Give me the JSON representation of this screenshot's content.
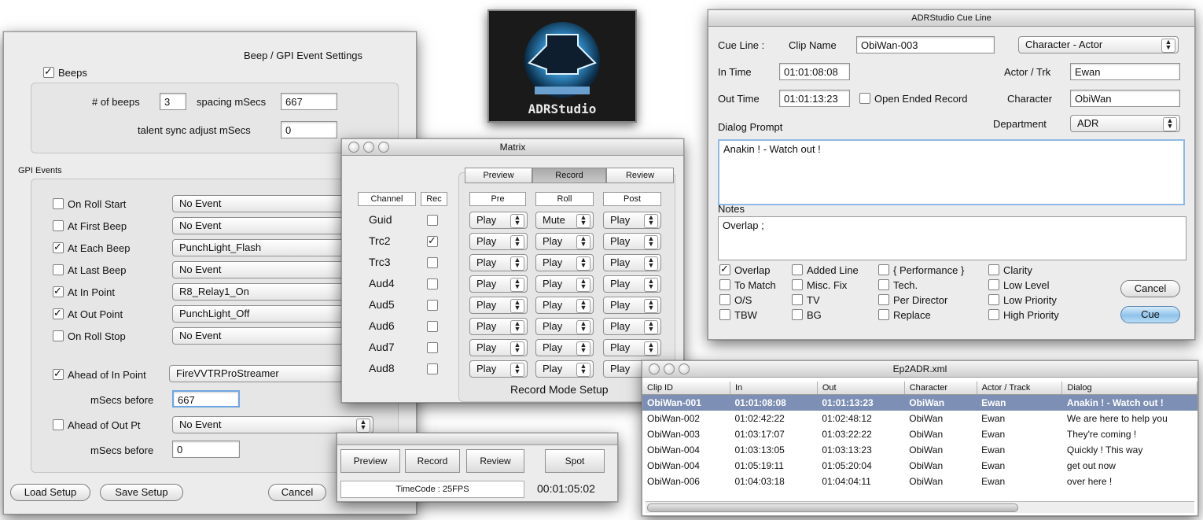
{
  "beep": {
    "title": "Beep / GPI Event Settings",
    "beeps_label": "Beeps",
    "num_beeps_label": "# of beeps",
    "num_beeps": "3",
    "spacing_label": "spacing mSecs",
    "spacing": "667",
    "talent_label": "talent sync adjust mSecs",
    "talent": "0",
    "gpi_label": "GPI Events",
    "events": [
      {
        "label": "On Roll Start",
        "checked": false,
        "value": "No Event"
      },
      {
        "label": "At First Beep",
        "checked": false,
        "value": "No Event"
      },
      {
        "label": "At Each Beep",
        "checked": true,
        "value": "PunchLight_Flash"
      },
      {
        "label": "At Last Beep",
        "checked": false,
        "value": "No Event"
      },
      {
        "label": "At In Point",
        "checked": true,
        "value": "R8_Relay1_On"
      },
      {
        "label": "At Out Point",
        "checked": true,
        "value": "PunchLight_Off"
      },
      {
        "label": "On Roll Stop",
        "checked": false,
        "value": "No Event"
      }
    ],
    "ahead_in_label": "Ahead of In Point",
    "ahead_in_value": "FireVVTRProStreamer",
    "msecs_before_label": "mSecs before",
    "ahead_in_msecs": "667",
    "ahead_out_label": "Ahead of Out Pt",
    "ahead_out_value": "No Event",
    "ahead_out_msecs": "0",
    "load": "Load Setup",
    "save": "Save Setup",
    "cancel": "Cancel"
  },
  "logo": {
    "text": "ADRStudio"
  },
  "matrix": {
    "title": "Matrix",
    "tabs": [
      "Preview",
      "Record",
      "Review"
    ],
    "channel_header": "Channel",
    "rec_header": "Rec",
    "col_headers": [
      "Pre",
      "Roll",
      "Post"
    ],
    "rows": [
      {
        "name": "Guid",
        "rec": false,
        "pre": "Play",
        "roll": "Mute",
        "post": "Play"
      },
      {
        "name": "Trc2",
        "rec": true,
        "pre": "Play",
        "roll": "Play",
        "post": "Play"
      },
      {
        "name": "Trc3",
        "rec": false,
        "pre": "Play",
        "roll": "Play",
        "post": "Play"
      },
      {
        "name": "Aud4",
        "rec": false,
        "pre": "Play",
        "roll": "Play",
        "post": "Play"
      },
      {
        "name": "Aud5",
        "rec": false,
        "pre": "Play",
        "roll": "Play",
        "post": "Play"
      },
      {
        "name": "Aud6",
        "rec": false,
        "pre": "Play",
        "roll": "Play",
        "post": "Play"
      },
      {
        "name": "Aud7",
        "rec": false,
        "pre": "Play",
        "roll": "Play",
        "post": "Play"
      },
      {
        "name": "Aud8",
        "rec": false,
        "pre": "Play",
        "roll": "Play",
        "post": "Play"
      }
    ],
    "footer": "Record Mode Setup"
  },
  "transport": {
    "buttons": [
      "Preview",
      "Record",
      "Review",
      "Spot"
    ],
    "timecode_label": "TimeCode : 25FPS",
    "timecode": "00:01:05:02"
  },
  "cue": {
    "title": "ADRStudio Cue Line",
    "cue_line_label": "Cue Line :",
    "clip_name_label": "Clip Name",
    "clip_name": "ObiWan-003",
    "sort_select": "Character - Actor",
    "in_time_label": "In Time",
    "in_time": "01:01:08:08",
    "actor_label": "Actor / Trk",
    "actor": "Ewan",
    "out_time_label": "Out Time",
    "out_time": "01:01:13:23",
    "open_ended_label": "Open Ended Record",
    "character_label": "Character",
    "character": "ObiWan",
    "dialog_label": "Dialog Prompt",
    "department_label": "Department",
    "department": "ADR",
    "dialog": "Anakin ! - Watch out !",
    "notes_label": "Notes",
    "notes": "Overlap ;",
    "checks": [
      [
        {
          "label": "Overlap",
          "on": true
        },
        {
          "label": "To Match",
          "on": false
        },
        {
          "label": "O/S",
          "on": false
        },
        {
          "label": "TBW",
          "on": false
        }
      ],
      [
        {
          "label": "Added Line",
          "on": false
        },
        {
          "label": "Misc. Fix",
          "on": false
        },
        {
          "label": "TV",
          "on": false
        },
        {
          "label": "BG",
          "on": false
        }
      ],
      [
        {
          "label": "{ Performance }",
          "on": false
        },
        {
          "label": "Tech.",
          "on": false
        },
        {
          "label": "Per Director",
          "on": false
        },
        {
          "label": "Replace",
          "on": false
        }
      ],
      [
        {
          "label": "Clarity",
          "on": false
        },
        {
          "label": "Low Level",
          "on": false
        },
        {
          "label": "Low Priority",
          "on": false
        },
        {
          "label": "High Priority",
          "on": false
        }
      ]
    ],
    "cancel": "Cancel",
    "cue_button": "Cue"
  },
  "list": {
    "title": "Ep2ADR.xml",
    "columns": [
      "Clip ID",
      "In",
      "Out",
      "Character",
      "Actor / Track",
      "Dialog"
    ],
    "rows": [
      [
        "ObiWan-001",
        "01:01:08:08",
        "01:01:13:23",
        "ObiWan",
        "Ewan",
        "Anakin ! - Watch out !"
      ],
      [
        "ObiWan-002",
        "01:02:42:22",
        "01:02:48:12",
        "ObiWan",
        "Ewan",
        "We are here to help you"
      ],
      [
        "ObiWan-003",
        "01:03:17:07",
        "01:03:22:22",
        "ObiWan",
        "Ewan",
        "They're coming !"
      ],
      [
        "ObiWan-004",
        "01:03:13:05",
        "01:03:13:23",
        "ObiWan",
        "Ewan",
        "Quickly ! This way"
      ],
      [
        "ObiWan-004",
        "01:05:19:11",
        "01:05:20:04",
        "ObiWan",
        "Ewan",
        "get out now"
      ],
      [
        "ObiWan-006",
        "01:04:03:18",
        "01:04:04:11",
        "ObiWan",
        "Ewan",
        "over here !"
      ]
    ],
    "selected_row": 0
  }
}
